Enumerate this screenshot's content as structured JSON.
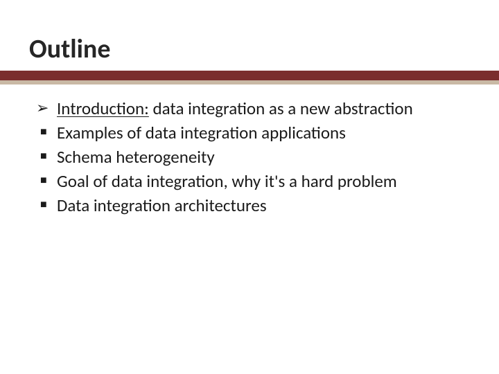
{
  "title": "Outline",
  "items": [
    {
      "bullet": "arrow",
      "prefix_underline": "Introduction:",
      "rest": " data integration as a new abstraction"
    },
    {
      "bullet": "square",
      "text": "Examples of data integration applications"
    },
    {
      "bullet": "square",
      "text": "Schema heterogeneity"
    },
    {
      "bullet": "square",
      "text": "Goal of data integration, why it's a hard problem"
    },
    {
      "bullet": "square",
      "text": "Data integration architectures"
    }
  ],
  "colors": {
    "accent_dark": "#7a2e2e",
    "accent_light": "#c9b9a5"
  }
}
